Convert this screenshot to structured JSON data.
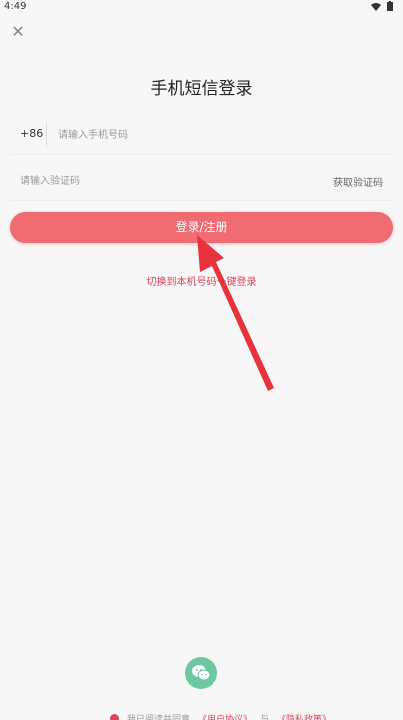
{
  "status_bar": {
    "time": "4:49"
  },
  "title": "手机短信登录",
  "phone": {
    "prefix": "+86",
    "placeholder": "请输入手机号码"
  },
  "code": {
    "placeholder": "请输入验证码",
    "get_code_label": "获取验证码"
  },
  "submit_label": "登录/注册",
  "switch_label": "切换到本机号码一键登录",
  "agreement": {
    "text": "我已阅读并同意",
    "user_agreement": "《用户协议》",
    "and": "与",
    "privacy": "《隐私政策》"
  },
  "colors": {
    "accent": "#f06b72",
    "link": "#e0445a",
    "wechat": "#6cc8a1"
  }
}
